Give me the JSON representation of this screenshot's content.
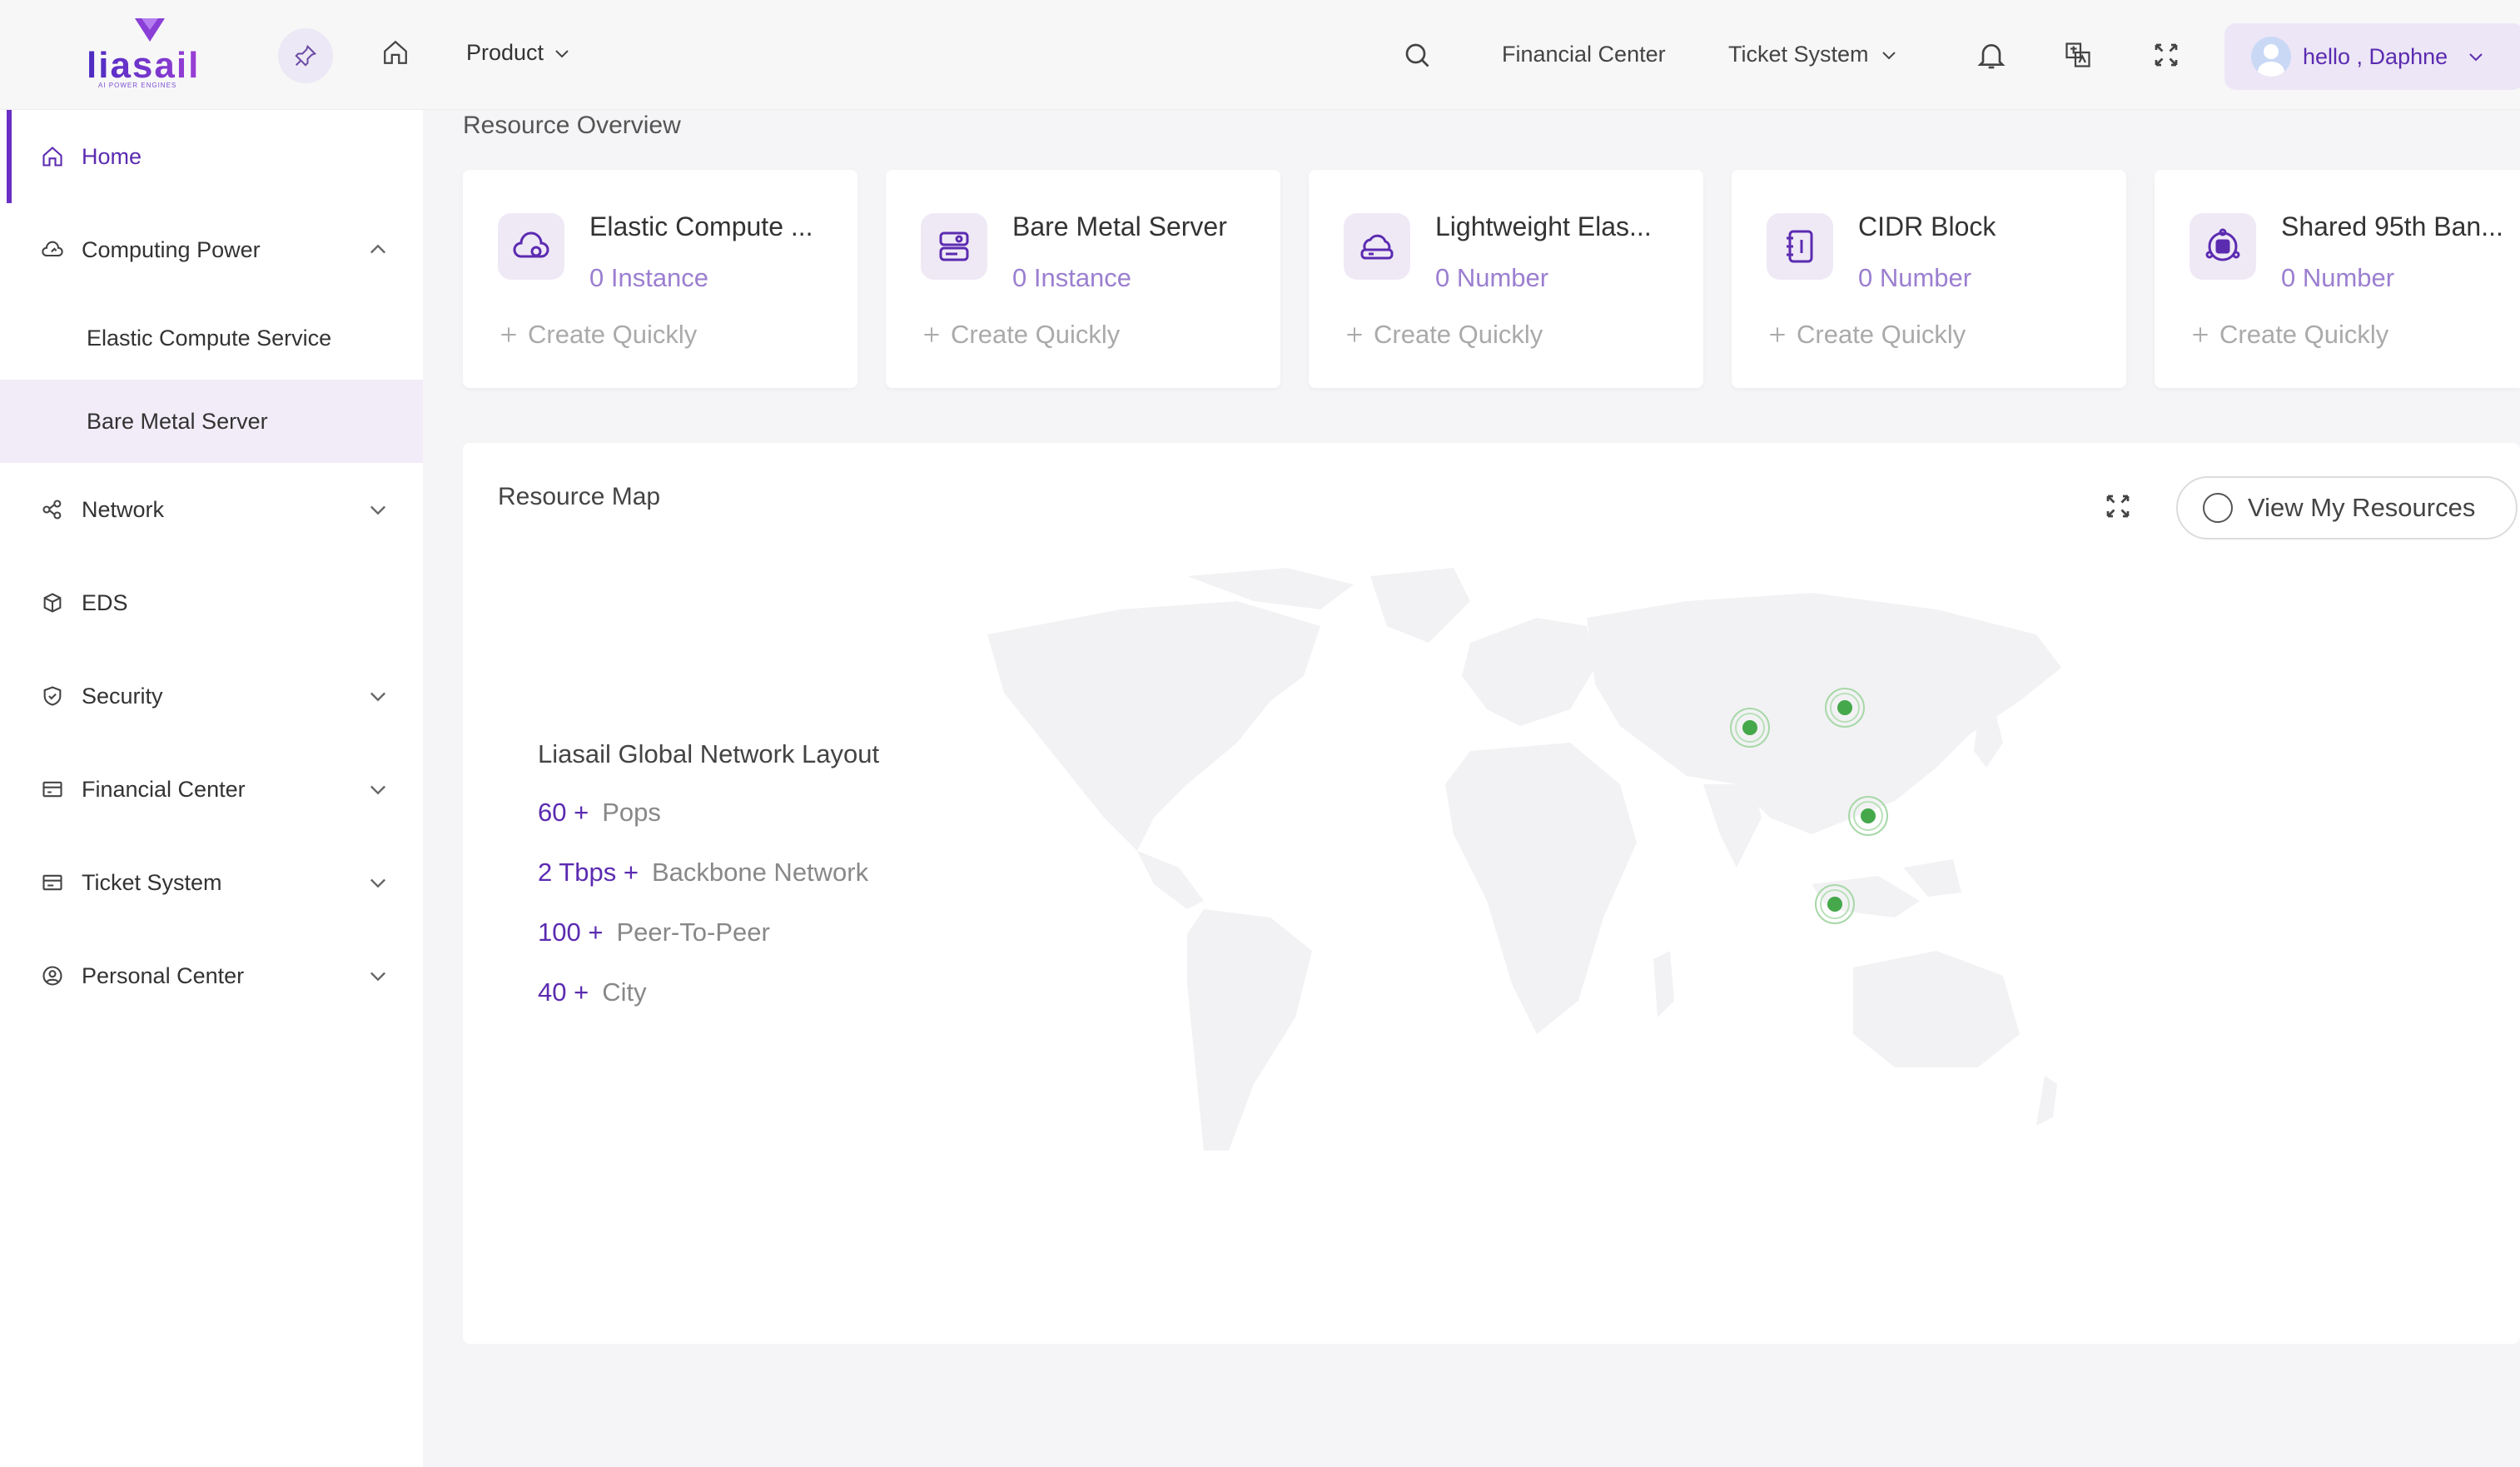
{
  "header": {
    "logo_text": "liasail",
    "logo_sub": "AI POWER ENGINES",
    "product_label": "Product",
    "financial_center": "Financial Center",
    "ticket_system": "Ticket System",
    "user_greeting": "hello , Daphne"
  },
  "sidebar": {
    "items": [
      {
        "label": "Home"
      },
      {
        "label": "Computing Power"
      },
      {
        "label": "Elastic Compute Service"
      },
      {
        "label": "Bare Metal Server"
      },
      {
        "label": "Network"
      },
      {
        "label": "EDS"
      },
      {
        "label": "Security"
      },
      {
        "label": "Financial Center"
      },
      {
        "label": "Ticket System"
      },
      {
        "label": "Personal Center"
      }
    ]
  },
  "overview": {
    "title": "Resource Overview",
    "cards": [
      {
        "title": "Elastic Compute ...",
        "count": "0 Instance",
        "action": "Create Quickly",
        "icon": "cloud-compute-icon"
      },
      {
        "title": "Bare Metal Server",
        "count": "0 Instance",
        "action": "Create Quickly",
        "icon": "server-icon"
      },
      {
        "title": "Lightweight Elas...",
        "count": "0 Number",
        "action": "Create Quickly",
        "icon": "cloud-drive-icon"
      },
      {
        "title": "CIDR Block",
        "count": "0 Number",
        "action": "Create Quickly",
        "icon": "notebook-icon"
      },
      {
        "title": "Shared 95th Ban...",
        "count": "0 Number",
        "action": "Create Quickly",
        "icon": "bandwidth-icon"
      }
    ]
  },
  "map": {
    "title": "Resource Map",
    "view_button": "View My Resources",
    "network_title": "Liasail Global Network Layout",
    "stats": [
      {
        "value": "60 +",
        "label": "Pops"
      },
      {
        "value": "2 Tbps +",
        "label": "Backbone Network"
      },
      {
        "value": "100 +",
        "label": "Peer-To-Peer"
      },
      {
        "value": "40 +",
        "label": "City"
      }
    ]
  },
  "colors": {
    "accent": "#5b2bb0",
    "pin": "#45a84a"
  }
}
